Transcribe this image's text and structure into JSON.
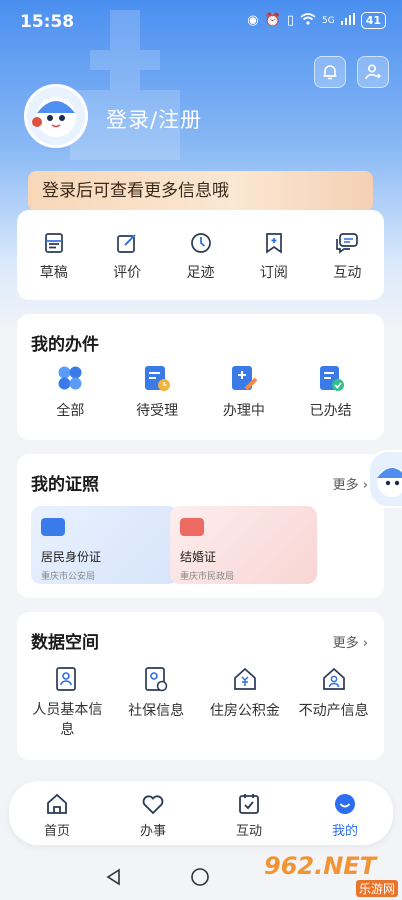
{
  "status_bar": {
    "time": "15:58",
    "network": "5G",
    "battery": "41"
  },
  "header": {
    "login_text": "登录/注册"
  },
  "banner": {
    "text": "登录后可查看更多信息哦"
  },
  "quick_actions": [
    {
      "label": "草稿",
      "icon": "draft-icon"
    },
    {
      "label": "评价",
      "icon": "edit-icon"
    },
    {
      "label": "足迹",
      "icon": "clock-icon"
    },
    {
      "label": "订阅",
      "icon": "bookmark-icon"
    },
    {
      "label": "互动",
      "icon": "chat-icon"
    }
  ],
  "my_affairs": {
    "title": "我的办件",
    "items": [
      {
        "label": "全部",
        "icon": "grid-icon"
      },
      {
        "label": "待受理",
        "icon": "pending-icon"
      },
      {
        "label": "办理中",
        "icon": "processing-icon"
      },
      {
        "label": "已办结",
        "icon": "done-icon"
      }
    ]
  },
  "my_certificates": {
    "title": "我的证照",
    "more": "更多",
    "items": [
      {
        "name": "居民身份证",
        "org": "重庆市公安局"
      },
      {
        "name": "结婚证",
        "org": "重庆市民政局"
      }
    ]
  },
  "data_space": {
    "title": "数据空间",
    "more": "更多",
    "items": [
      {
        "label": "人员基本信息",
        "icon": "person-doc-icon"
      },
      {
        "label": "社保信息",
        "icon": "social-security-icon"
      },
      {
        "label": "住房公积金",
        "icon": "housing-fund-icon"
      },
      {
        "label": "不动产信息",
        "icon": "real-estate-icon"
      }
    ]
  },
  "tabbar": [
    {
      "label": "首页",
      "icon": "home-icon"
    },
    {
      "label": "办事",
      "icon": "heart-icon"
    },
    {
      "label": "互动",
      "icon": "calendar-check-icon"
    },
    {
      "label": "我的",
      "icon": "profile-smile-icon",
      "active": true
    }
  ],
  "watermark": {
    "text": "962.NET",
    "sub": "乐游网"
  },
  "colors": {
    "accent": "#2d6ef0",
    "icon_blue": "#2f6fe4"
  }
}
